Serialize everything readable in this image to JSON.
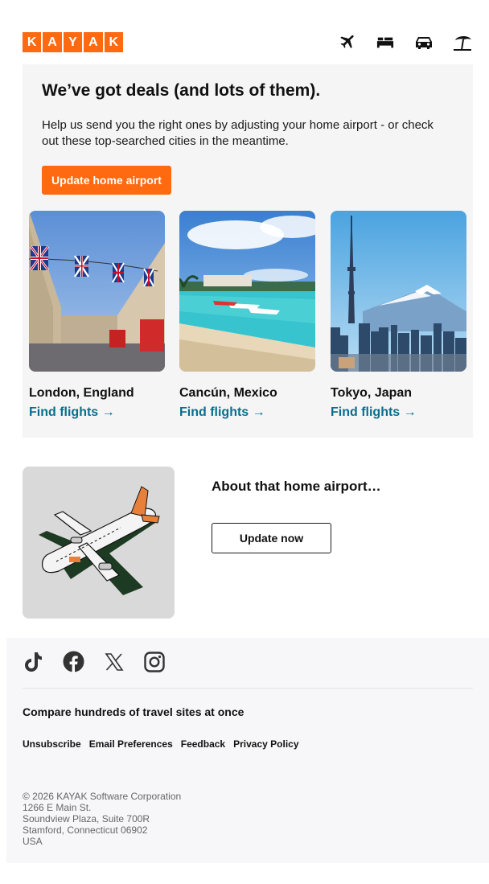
{
  "brand": {
    "letters": [
      "K",
      "A",
      "Y",
      "A",
      "K"
    ],
    "color": "#ff690f"
  },
  "nav": {
    "icons": [
      "plane-icon",
      "bed-icon",
      "car-icon",
      "beach-umbrella-icon"
    ]
  },
  "deals": {
    "heading": "We’ve got deals (and lots of them).",
    "body": "Help us send you the right ones by adjusting your home airport - or check out these top-searched cities in the meantime.",
    "button_label": "Update home airport",
    "background": "#f5f5f5",
    "cities": [
      {
        "name": "London, England",
        "link": "Find flights →"
      },
      {
        "name": "Cancún, Mexico",
        "link": "Find flights →"
      },
      {
        "name": "Tokyo, Japan",
        "link": "Find flights →"
      }
    ]
  },
  "about": {
    "title": "About that home airport…",
    "button_label": "Update now"
  },
  "footer": {
    "social": [
      "tiktok-icon",
      "facebook-icon",
      "x-icon",
      "instagram-icon"
    ],
    "tagline": "Compare hundreds of travel sites at once",
    "links": [
      "Unsubscribe",
      "Email Preferences",
      "Feedback",
      "Privacy Policy"
    ],
    "address": [
      "© 2026 KAYAK Software Corporation",
      "1266 E Main St.",
      "Soundview Plaza, Suite 700R",
      "Stamford, Connecticut 06902",
      "USA"
    ]
  },
  "colors": {
    "accent": "#ff690f",
    "link": "#0a6e8f"
  }
}
